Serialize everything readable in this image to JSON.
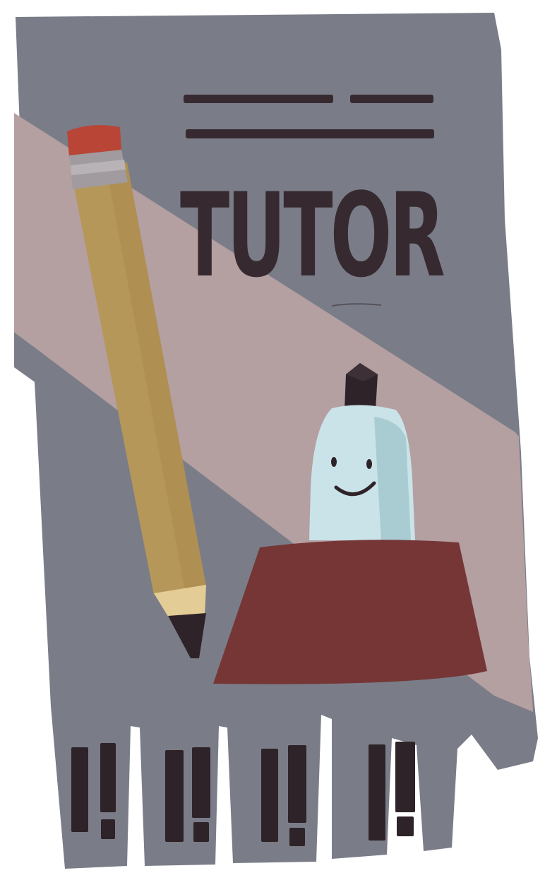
{
  "flyer": {
    "title": "TUTOR",
    "colors": {
      "paper": "#7a7d88",
      "diagonal_band": "#b49fa1",
      "ink": "#362a30",
      "pencil_body": "#b6975a",
      "pencil_eraser": "#b84535",
      "pencil_ferrule": "#a19b9f",
      "pencil_wood": "#e4cc96",
      "character_body": "#c9e3e9",
      "character_shade": "#a8ccd1",
      "character_cap": "#2e2328",
      "pedestal": "#763636",
      "background": "#ffffff"
    },
    "illustration": {
      "pencil": "pencil-icon",
      "character": "smiling-eraser-character",
      "pedestal": "red-pedestal"
    },
    "tear_off_tabs": {
      "count": 4,
      "glyph": "exclamation-marks"
    }
  }
}
